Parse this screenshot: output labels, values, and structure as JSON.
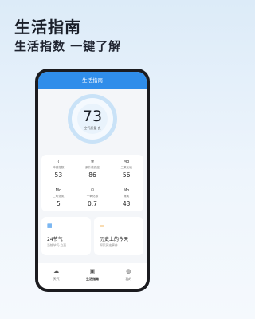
{
  "promo": {
    "title": "生活指南",
    "subtitle": "生活指数 一键了解"
  },
  "app": {
    "header_title": "生活指南",
    "aqi": {
      "value": "73",
      "label": "空气质量·良"
    },
    "metrics": [
      {
        "icon": "humidity-icon",
        "glyph": "⌇",
        "label": "体感指数",
        "value": "53"
      },
      {
        "icon": "wind-icon",
        "glyph": "✲",
        "label": "紫外线强度",
        "value": "86"
      },
      {
        "icon": "pm25-icon",
        "glyph": "Mo",
        "label": "二氧化硫",
        "value": "56"
      },
      {
        "icon": "pm25-icon",
        "glyph": "Mo",
        "label": "二氧化氮",
        "value": "5"
      },
      {
        "icon": "co-icon",
        "glyph": "⊡",
        "label": "一氧化碳",
        "value": "0.7"
      },
      {
        "icon": "o3-icon",
        "glyph": "Mo",
        "label": "臭氧",
        "value": "43"
      }
    ],
    "tiles": [
      {
        "icon": "calendar-icon",
        "glyph": "▦",
        "title": "24节气",
        "subtitle": "当前节气:立夏"
      },
      {
        "icon": "history-icon",
        "glyph": "▭",
        "title": "历史上的今天",
        "subtitle": "探索历史事件"
      }
    ],
    "nav": [
      {
        "icon": "weather-icon",
        "glyph": "☁",
        "label": "天气"
      },
      {
        "icon": "guide-icon",
        "glyph": "▣",
        "label": "生活指南"
      },
      {
        "icon": "profile-icon",
        "glyph": "◍",
        "label": "我的"
      }
    ]
  }
}
